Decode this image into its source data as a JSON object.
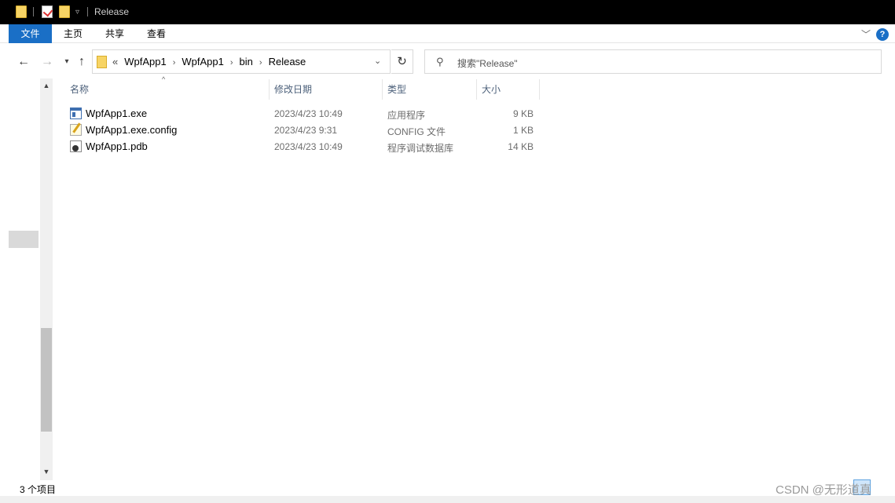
{
  "window": {
    "title": "Release"
  },
  "ribbon": {
    "tabs": [
      "文件",
      "主页",
      "共享",
      "查看"
    ]
  },
  "address": {
    "overflow": "«",
    "crumbs": [
      "WpfApp1",
      "WpfApp1",
      "bin",
      "Release"
    ]
  },
  "search": {
    "placeholder": "搜索\"Release\""
  },
  "columns": {
    "name": "名称",
    "date": "修改日期",
    "type": "类型",
    "size": "大小"
  },
  "files": [
    {
      "name": "WpfApp1.exe",
      "date": "2023/4/23 10:49",
      "type": "应用程序",
      "size": "9 KB",
      "icon": "exe-icon"
    },
    {
      "name": "WpfApp1.exe.config",
      "date": "2023/4/23 9:31",
      "type": "CONFIG 文件",
      "size": "1 KB",
      "icon": "config-file-icon"
    },
    {
      "name": "WpfApp1.pdb",
      "date": "2023/4/23 10:49",
      "type": "程序调试数据库",
      "size": "14 KB",
      "icon": "pdb-file-icon"
    }
  ],
  "status": {
    "count": "3 个项目"
  },
  "watermark": "CSDN @无形道真",
  "colors": {
    "accent": "#1a6fc6",
    "titlebar": "#000000"
  }
}
